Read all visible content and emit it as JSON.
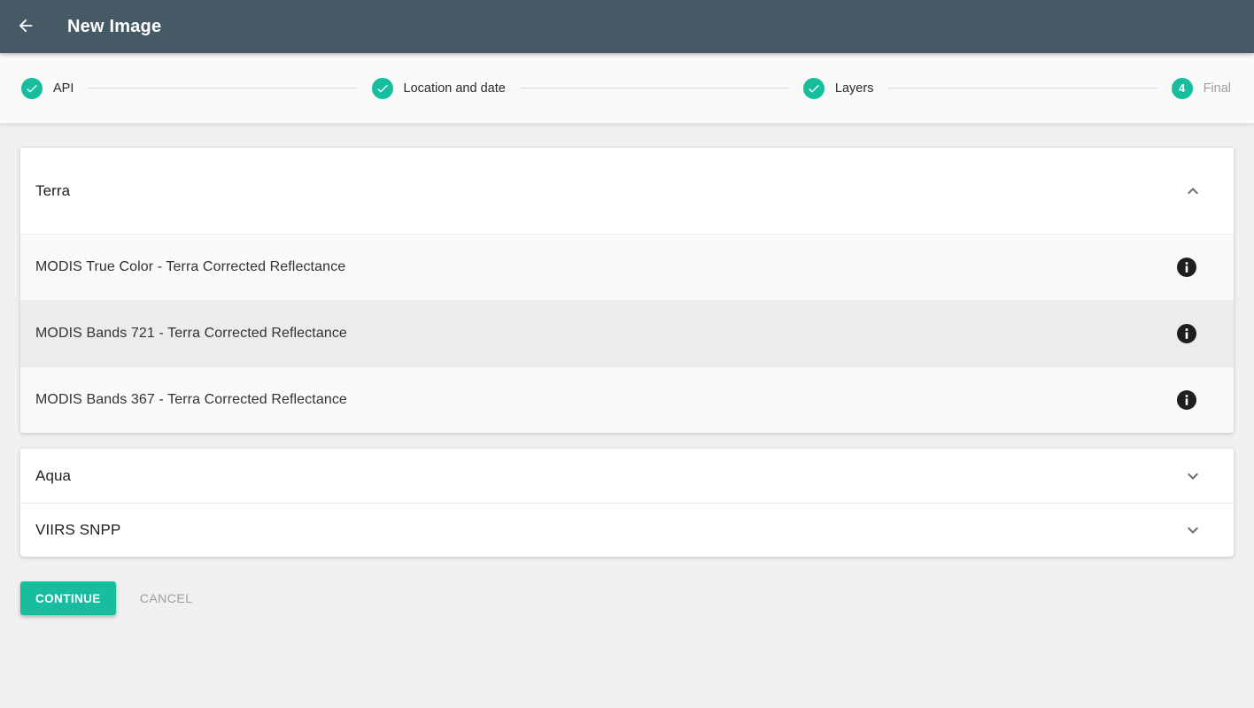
{
  "header": {
    "title": "New Image"
  },
  "stepper": {
    "steps": [
      {
        "label": "API",
        "state": "completed",
        "icon": "check"
      },
      {
        "label": "Location and date",
        "state": "completed",
        "icon": "check"
      },
      {
        "label": "Layers",
        "state": "completed",
        "icon": "check"
      },
      {
        "label": "Final",
        "state": "current",
        "number": "4"
      }
    ]
  },
  "panels": {
    "terra": {
      "title": "Terra",
      "expanded": true,
      "items": [
        {
          "label": "MODIS True Color - Terra Corrected Reflectance",
          "selected": false,
          "info_icon": "info"
        },
        {
          "label": "MODIS Bands 721 - Terra Corrected Reflectance",
          "selected": true,
          "info_icon": "info"
        },
        {
          "label": "MODIS Bands 367 - Terra Corrected Reflectance",
          "selected": false,
          "info_icon": "info"
        }
      ]
    },
    "aqua": {
      "title": "Aqua",
      "expanded": false
    },
    "viirs": {
      "title": "VIIRS SNPP",
      "expanded": false
    }
  },
  "actions": {
    "continue_label": "CONTINUE",
    "cancel_label": "CANCEL"
  },
  "colors": {
    "appbar_bg": "#455a64",
    "accent_teal": "#17bd9d",
    "selected_row_bg": "#ececec",
    "muted_label": "#9e9e9e",
    "info_icon_bg": "#1e1e1e"
  }
}
